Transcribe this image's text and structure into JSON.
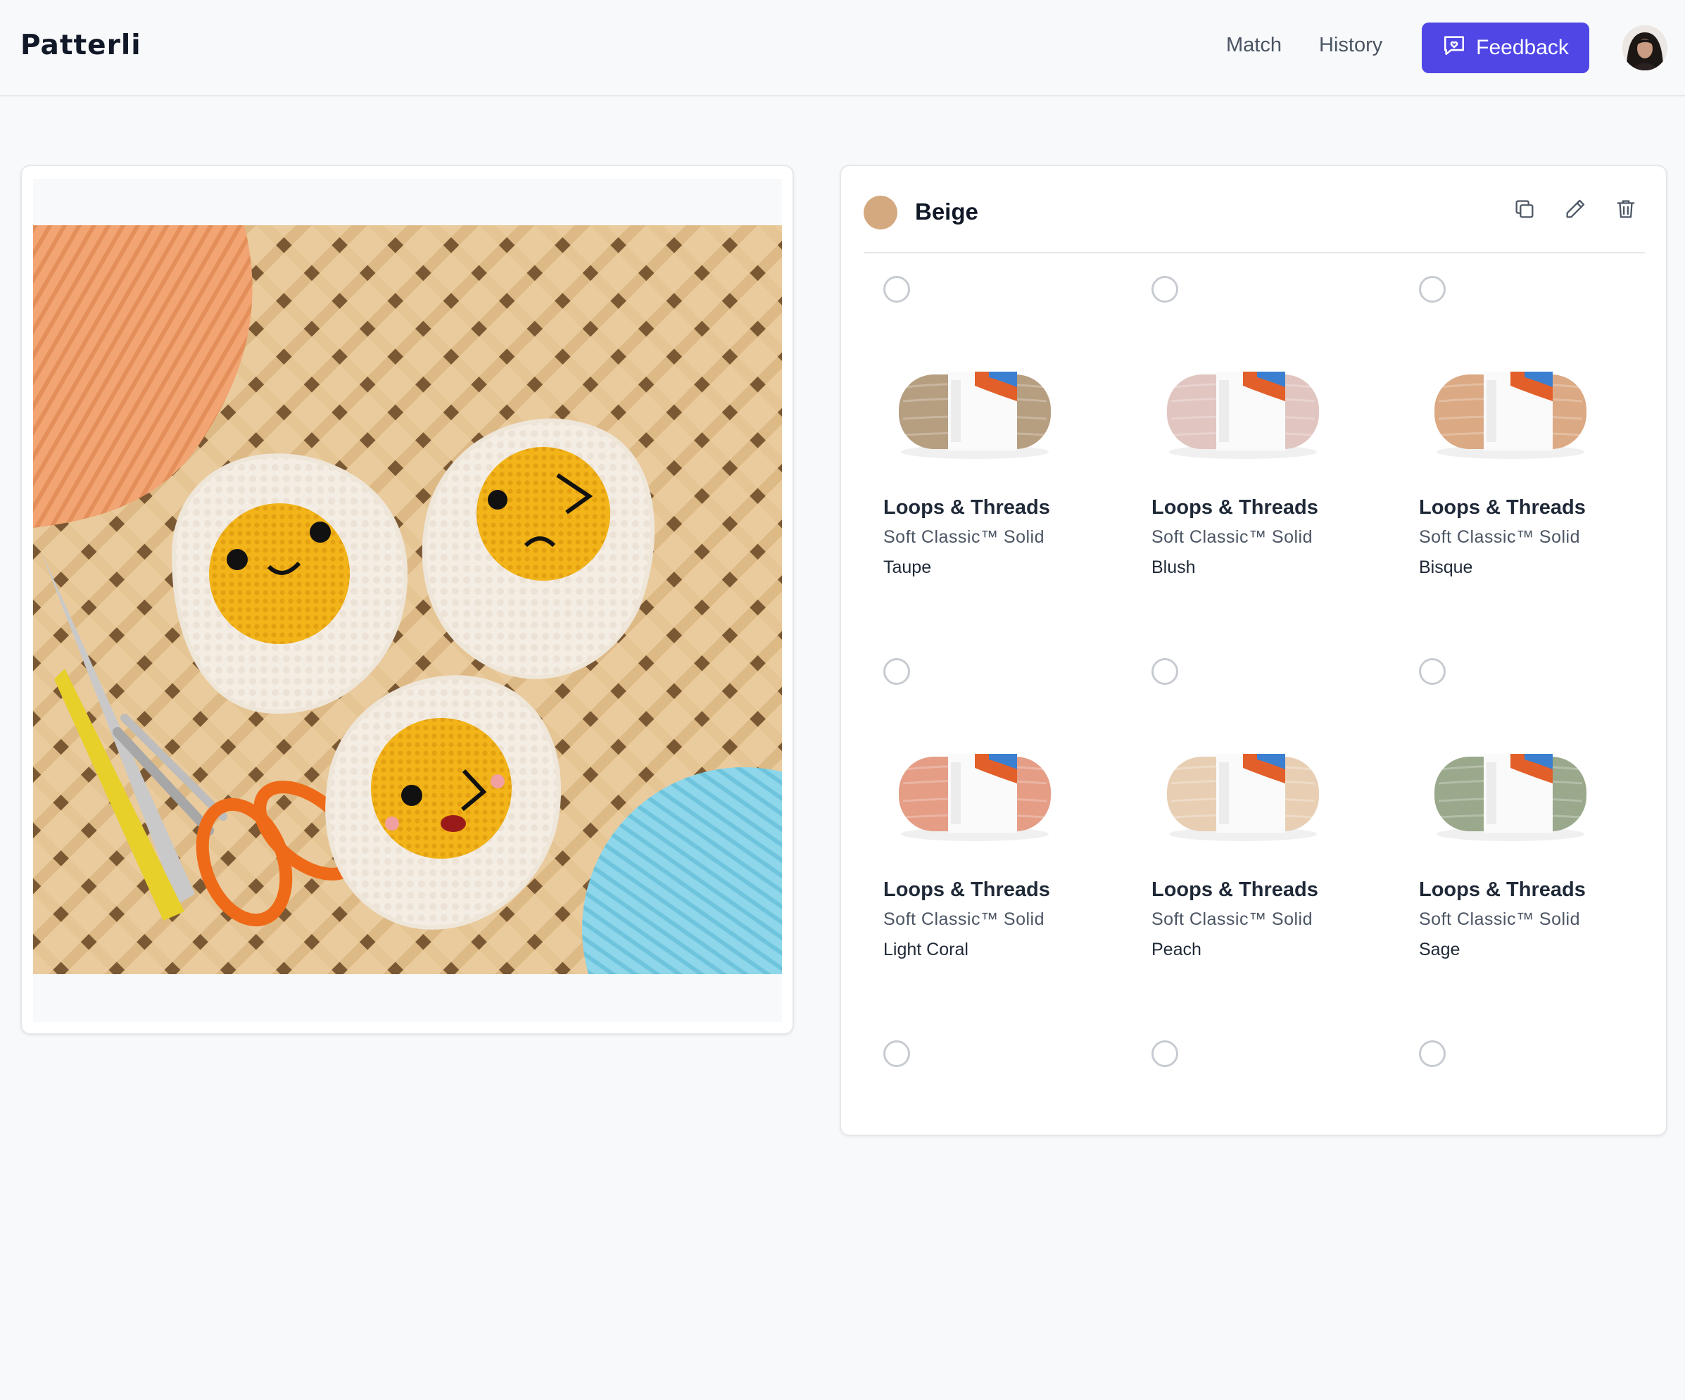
{
  "app": {
    "title": "Patterli"
  },
  "nav": {
    "match": "Match",
    "history": "History",
    "feedback": "Feedback"
  },
  "icons": {
    "feedback": "message-heart-icon",
    "copy": "copy-icon",
    "edit": "pencil-icon",
    "delete": "trash-icon",
    "radio": "radio-unchecked-icon"
  },
  "colors": {
    "accent": "#4f46e5",
    "swatch": "#d4a97f"
  },
  "match_group": {
    "color_name": "Beige",
    "swatch_color": "#d4a97f"
  },
  "yarns": [
    {
      "brand": "Loops & Threads",
      "line": "Soft Classic™ Solid",
      "color": "Taupe",
      "hex": "#c2a888",
      "selected": false
    },
    {
      "brand": "Loops & Threads",
      "line": "Soft Classic™ Solid",
      "color": "Blush",
      "hex": "#efd2cd",
      "selected": false
    },
    {
      "brand": "Loops & Threads",
      "line": "Soft Classic™ Solid",
      "color": "Bisque",
      "hex": "#e9b48c",
      "selected": false
    },
    {
      "brand": "Loops & Threads",
      "line": "Soft Classic™ Solid",
      "color": "Light Coral",
      "hex": "#f4a78e",
      "selected": false
    },
    {
      "brand": "Loops & Threads",
      "line": "Soft Classic™ Solid",
      "color": "Peach",
      "hex": "#f7dcc0",
      "selected": false
    },
    {
      "brand": "Loops & Threads",
      "line": "Soft Classic™ Solid",
      "color": "Sage",
      "hex": "#a4b394",
      "selected": false
    },
    {
      "selected": false
    },
    {
      "selected": false
    },
    {
      "selected": false
    }
  ]
}
